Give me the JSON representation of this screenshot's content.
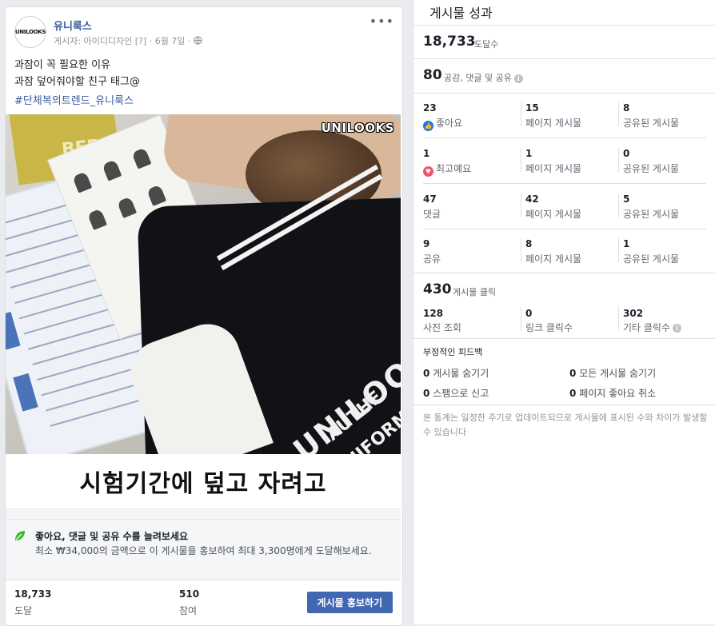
{
  "post": {
    "avatar_text": "UNILOOKS",
    "page_name": "유니룩스",
    "meta": "게시자: 아이디디자인 [?] · 6월 7일 · ",
    "globe_icon": "globe-icon",
    "more_icon": "more-icon",
    "text_line1": "과잠이 꼭 필요한 이유",
    "text_line2": "과잠 덮어줘야할 친구 태그@",
    "hashtag": "#단체복의트렌드_유니룩스",
    "image": {
      "badge": "UNILOOKS",
      "magazine_text": "BERUT",
      "jacket_big": "UNILOOKS",
      "jacket_line2": "AUTHE",
      "jacket_line3": "UNIFORM"
    },
    "caption": "시험기간에 덮고 자려고",
    "promo": {
      "icon": "leaf-icon",
      "title": "좋아요, 댓글 및 공유 수를 늘려보세요",
      "description": "최소 ₩34,000의 금액으로 이 게시물을 홍보하여 최대 3,300명에게 도달해보세요."
    },
    "stats": {
      "reach_value": "18,733",
      "reach_label": "도달",
      "engagement_value": "510",
      "engagement_label": "참여",
      "boost_button": "게시물 홍보하기"
    }
  },
  "insights": {
    "title": "게시물 성과",
    "reach_value": "18,733",
    "reach_label": "도달수",
    "engage_value": "80",
    "engage_label": "공감, 댓글 및 공유",
    "rows": [
      {
        "total": "23",
        "label": "좋아요",
        "icon": "like-icon",
        "on_page": "15",
        "on_page_label": "페이지 게시물",
        "shared": "8",
        "shared_label": "공유된 게시물"
      },
      {
        "total": "1",
        "label": "최고예요",
        "icon": "love-icon",
        "on_page": "1",
        "on_page_label": "페이지 게시물",
        "shared": "0",
        "shared_label": "공유된 게시물"
      },
      {
        "total": "47",
        "label": "댓글",
        "on_page": "42",
        "on_page_label": "페이지 게시물",
        "shared": "5",
        "shared_label": "공유된 게시물"
      },
      {
        "total": "9",
        "label": "공유",
        "on_page": "8",
        "on_page_label": "페이지 게시물",
        "shared": "1",
        "shared_label": "공유된 게시물"
      }
    ],
    "clicks_value": "430",
    "clicks_label": "게시물 클릭",
    "clicks": [
      {
        "value": "128",
        "label": "사진 조회"
      },
      {
        "value": "0",
        "label": "링크 클릭수"
      },
      {
        "value": "302",
        "label": "기타 클릭수"
      }
    ],
    "negative": {
      "title": "부정적인 피드백",
      "items": [
        {
          "value": "0",
          "label": "게시물 숨기기"
        },
        {
          "value": "0",
          "label": "모든 게시물 숨기기"
        },
        {
          "value": "0",
          "label": "스팸으로 신고"
        },
        {
          "value": "0",
          "label": "페이지 좋아요 취소"
        }
      ]
    },
    "footnote": "본 통계는 일정한 주기로 업데이트되므로 게시물에 표시된 수와 차이가 발생할 수 있습니다"
  }
}
